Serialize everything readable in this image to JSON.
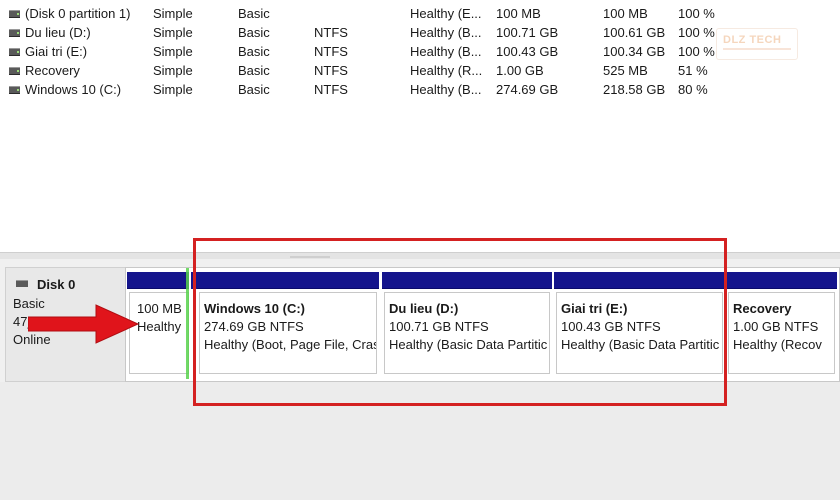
{
  "volume_list": {
    "rows": [
      {
        "volume": "(Disk 0 partition 1)",
        "layout": "Simple",
        "type": "Basic",
        "file_system": "",
        "status": "Healthy (E...",
        "capacity": "100 MB",
        "free_space": "100 MB",
        "percent_free": "100 %"
      },
      {
        "volume": "Du lieu (D:)",
        "layout": "Simple",
        "type": "Basic",
        "file_system": "NTFS",
        "status": "Healthy (B...",
        "capacity": "100.71 GB",
        "free_space": "100.61 GB",
        "percent_free": "100 %"
      },
      {
        "volume": "Giai tri (E:)",
        "layout": "Simple",
        "type": "Basic",
        "file_system": "NTFS",
        "status": "Healthy (B...",
        "capacity": "100.43 GB",
        "free_space": "100.34 GB",
        "percent_free": "100 %"
      },
      {
        "volume": "Recovery",
        "layout": "Simple",
        "type": "Basic",
        "file_system": "NTFS",
        "status": "Healthy (R...",
        "capacity": "1.00 GB",
        "free_space": "525 MB",
        "percent_free": "51 %"
      },
      {
        "volume": "Windows 10 (C:)",
        "layout": "Simple",
        "type": "Basic",
        "file_system": "NTFS",
        "status": "Healthy (B...",
        "capacity": "274.69 GB",
        "free_space": "218.58 GB",
        "percent_free": "80 %"
      }
    ]
  },
  "watermark": {
    "text": "DLZ TECH"
  },
  "disk": {
    "name": "Disk 0",
    "type": "Basic",
    "size": "47_ _0 GB",
    "status": "Online",
    "partitions": [
      {
        "title": "",
        "size": "100 MB",
        "status": "Healthy"
      },
      {
        "title": "Windows 10  (C:)",
        "size": "274.69 GB NTFS",
        "status": "Healthy (Boot, Page File, Cras"
      },
      {
        "title": "Du lieu  (D:)",
        "size": "100.71 GB NTFS",
        "status": "Healthy (Basic Data Partitic"
      },
      {
        "title": "Giai tri  (E:)",
        "size": "100.43 GB NTFS",
        "status": "Healthy (Basic Data Partitic"
      },
      {
        "title": "Recovery",
        "size": "1.00 GB NTFS",
        "status": "Healthy (Recov"
      }
    ]
  },
  "annotation": {
    "highlight_color": "#d42121",
    "arrow_color": "#e0141b"
  },
  "colors": {
    "partition_bar": "#14148c",
    "list_background": "#ffffff",
    "window_background": "#f0f0f0"
  }
}
